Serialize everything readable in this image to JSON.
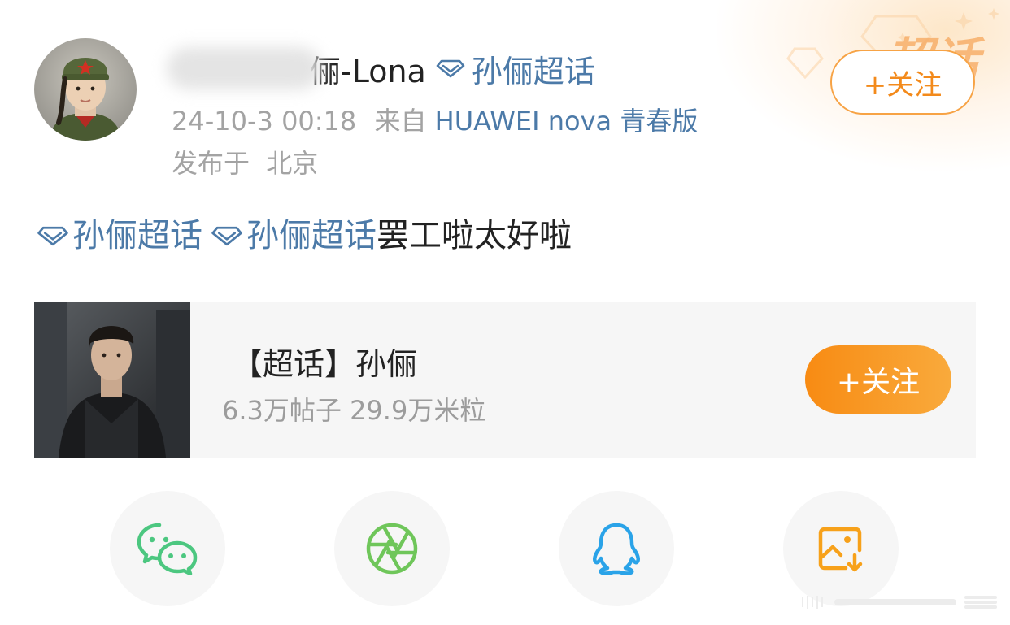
{
  "post": {
    "author_name_visible": "俪-Lona",
    "author_topic": "孙俪超话",
    "timestamp": "24-10-3 00:18",
    "source_prefix": "来自",
    "device": "HUAWEI nova 青春版",
    "location_prefix": "发布于",
    "location": "北京",
    "follow_label": "+关注",
    "body": {
      "tags": [
        "孙俪超话",
        "孙俪超话"
      ],
      "text": "罢工啦太好啦"
    }
  },
  "badge": {
    "text": "超话"
  },
  "supertopic_card": {
    "title": "【超话】孙俪",
    "stats": "6.3万帖子 29.9万米粒",
    "follow_label": "+关注"
  },
  "share": {
    "items": [
      {
        "icon": "wechat-icon"
      },
      {
        "icon": "moments-icon"
      },
      {
        "icon": "qq-icon"
      },
      {
        "icon": "save-image-icon"
      }
    ]
  },
  "colors": {
    "link_blue": "#4c7aa8",
    "accent_orange": "#f38a1b",
    "wechat_green": "#4cc780",
    "moments_green": "#6fc65a",
    "qq_blue": "#2aa3e8",
    "save_orange": "#f7a11a"
  }
}
